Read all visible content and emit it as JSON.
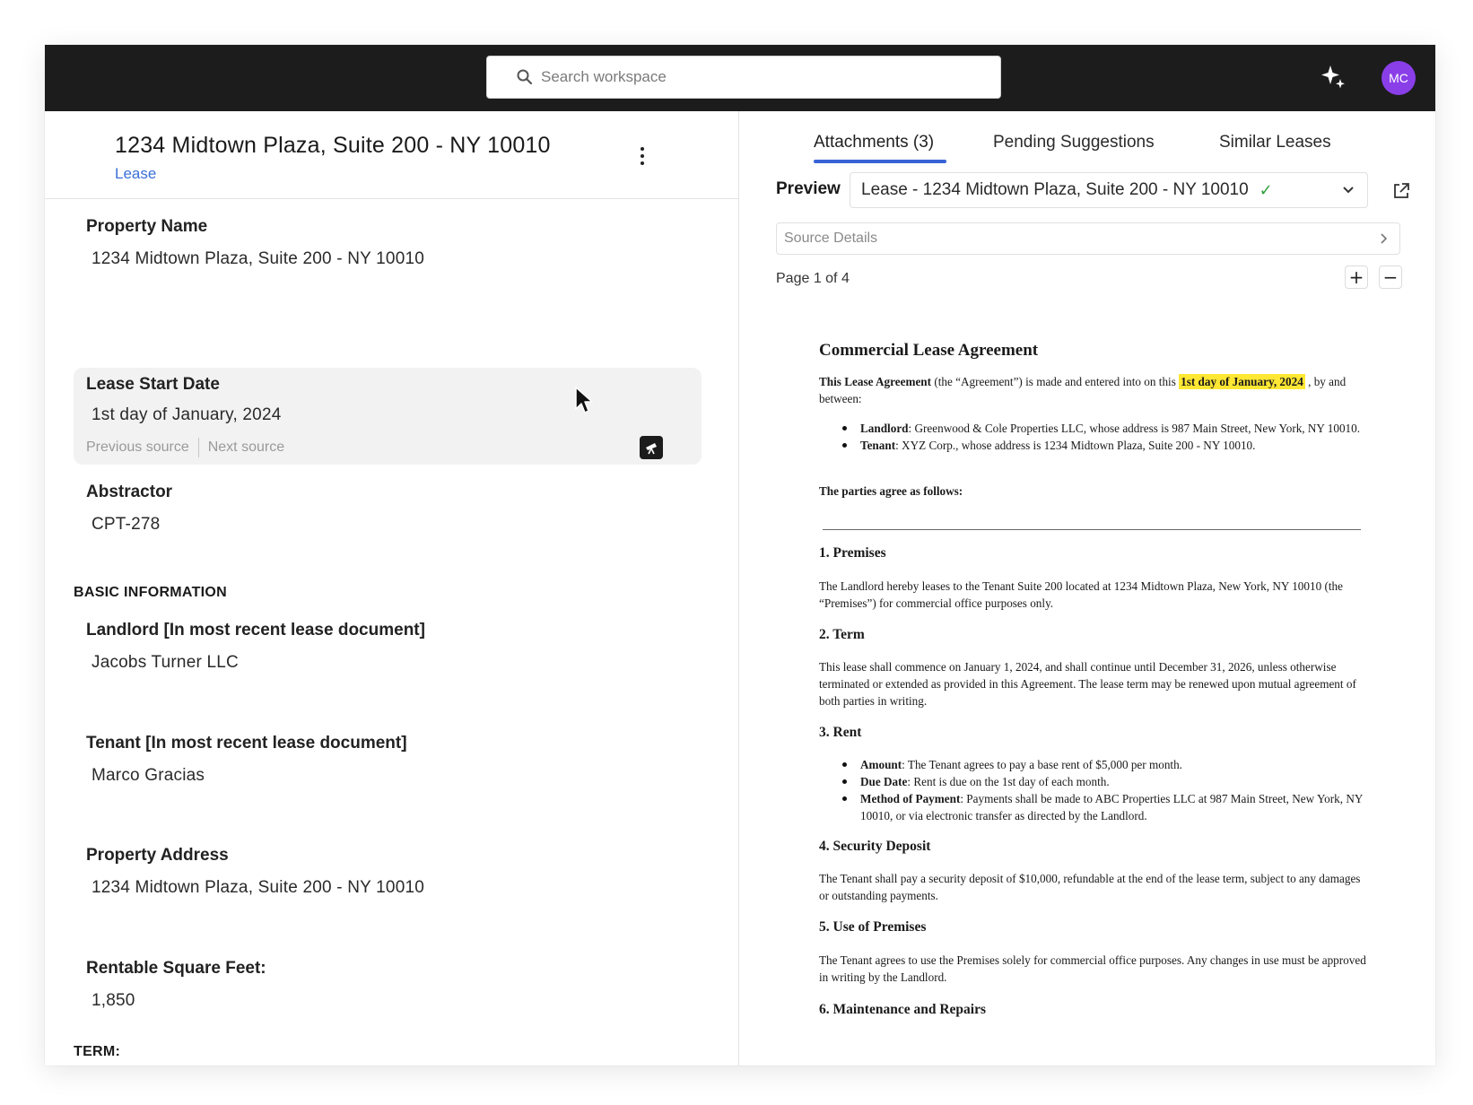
{
  "topbar": {
    "search_placeholder": "Search workspace",
    "avatar_initials": "MC",
    "avatar_color": "#8a3ee8"
  },
  "record": {
    "title": "1234 Midtown Plaza, Suite 200 - NY 10010",
    "type": "Lease"
  },
  "fields": {
    "property_name": {
      "label": "Property Name",
      "value": "1234 Midtown Plaza, Suite 200 - NY 10010"
    },
    "lease_start": {
      "label": "Lease Start Date",
      "value": "1st day of January, 2024",
      "prev_source": "Previous source",
      "next_source": "Next source"
    },
    "abstractor": {
      "label": "Abstractor",
      "value": "CPT-278"
    },
    "landlord": {
      "label": "Landlord [In most recent lease document]",
      "value": "Jacobs Turner LLC"
    },
    "tenant": {
      "label": "Tenant [In most recent lease document]",
      "value": "Marco Gracias"
    },
    "property_address": {
      "label": "Property Address",
      "value": "1234 Midtown Plaza, Suite 200 - NY 10010"
    },
    "rentable_sf": {
      "label": "Rentable Square Feet:",
      "value": "1,850"
    }
  },
  "sections": {
    "basic": "BASIC INFORMATION",
    "term": "TERM:"
  },
  "tabs": [
    {
      "label": "Attachments (3)",
      "active": true
    },
    {
      "label": "Pending Suggestions",
      "active": false
    },
    {
      "label": "Similar Leases",
      "active": false
    }
  ],
  "preview": {
    "label": "Preview",
    "selected": "Lease - 1234 Midtown Plaza, Suite 200 - NY 10010",
    "check": "✓",
    "source_details": "Source Details",
    "page_info": "Page 1 of 4",
    "zoom_in": "+",
    "zoom_out": "−"
  },
  "document": {
    "title": "Commercial Lease Agreement",
    "intro_bold": "This Lease Agreement",
    "intro_1": " (the “Agreement”) is made and entered into on this ",
    "intro_highlight": "1st day of January, 2024",
    "intro_2": " , by and between:",
    "parties": [
      {
        "role": "Landlord",
        "text": ": Greenwood & Cole Properties LLC, whose address is 987 Main Street, New York, NY 10010."
      },
      {
        "role": "Tenant",
        "text": ": XYZ Corp., whose address is 1234 Midtown Plaza, Suite 200 - NY 10010."
      }
    ],
    "agree": "The parties agree as follows:",
    "s1_title": "1. Premises",
    "s1_text": "The Landlord hereby leases to the Tenant Suite 200 located at 1234 Midtown Plaza, New York, NY 10010 (the “Premises”) for commercial office purposes only.",
    "s2_title": "2. Term",
    "s2_text": "This lease shall commence on January 1, 2024, and shall continue until December 31, 2026, unless otherwise terminated or extended as provided in this Agreement. The lease term may be renewed upon mutual agreement of both parties in writing.",
    "s3_title": "3. Rent",
    "rent_items": [
      {
        "term": "Amount",
        "text": ": The Tenant agrees to pay a base rent of $5,000 per month."
      },
      {
        "term": "Due Date",
        "text": ": Rent is due on the 1st day of each month."
      },
      {
        "term": "Method of Payment",
        "text": ": Payments shall be made to ABC Properties LLC at 987 Main Street, New York, NY 10010, or via electronic transfer as directed by the Landlord."
      }
    ],
    "s4_title": "4. Security Deposit",
    "s4_text": "The Tenant shall pay a security deposit of $10,000, refundable at the end of the lease term, subject to any damages or outstanding payments.",
    "s5_title": "5. Use of Premises",
    "s5_text": "The Tenant agrees to use the Premises solely for commercial office purposes. Any changes in use must be approved in writing by the Landlord.",
    "s6_title": "6. Maintenance and Repairs"
  }
}
